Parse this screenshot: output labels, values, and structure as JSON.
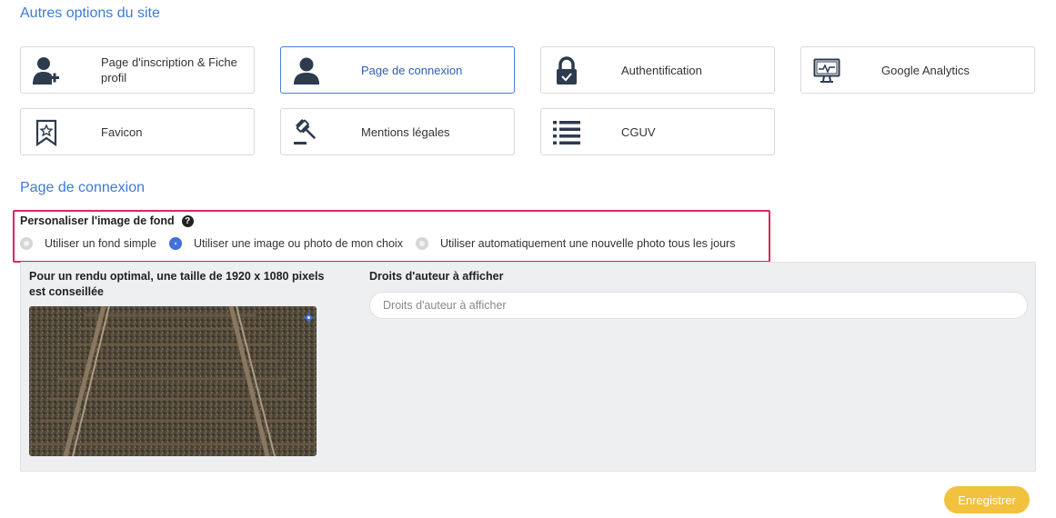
{
  "other_options": {
    "title": "Autres options du site",
    "cards": [
      {
        "label": "Page d'inscription & Fiche profil",
        "icon": "user-plus-icon"
      },
      {
        "label": "Page de connexion",
        "icon": "user-icon",
        "active": true
      },
      {
        "label": "Authentification",
        "icon": "lock-icon"
      },
      {
        "label": "Google Analytics",
        "icon": "monitor-chart-icon"
      },
      {
        "label": "Favicon",
        "icon": "bookmark-star-icon"
      },
      {
        "label": "Mentions légales",
        "icon": "gavel-icon"
      },
      {
        "label": "CGUV",
        "icon": "list-icon"
      }
    ]
  },
  "login_page": {
    "title": "Page de connexion",
    "background": {
      "label": "Personaliser l'image de fond",
      "help_icon": "help-circle-icon",
      "options": [
        {
          "label": "Utiliser un fond simple",
          "checked": false
        },
        {
          "label": "Utiliser une image ou photo de mon choix",
          "checked": true
        },
        {
          "label": "Utiliser automatiquement une nouvelle photo tous les jours",
          "checked": false
        }
      ]
    },
    "recommendation": "Pour un rendu optimal, une taille de  1920 x 1080 pixels est conseillée",
    "copyright": {
      "label": "Droits d'auteur à afficher",
      "placeholder": "Droits d'auteur à afficher",
      "value": ""
    },
    "photo_settings_icon": "gear-icon"
  },
  "actions": {
    "save_label": "Enregistrer"
  },
  "colors": {
    "accent": "#3b7bd8",
    "save": "#f2c23e",
    "highlight": "#e0245e",
    "icon": "#2d3b4e"
  }
}
